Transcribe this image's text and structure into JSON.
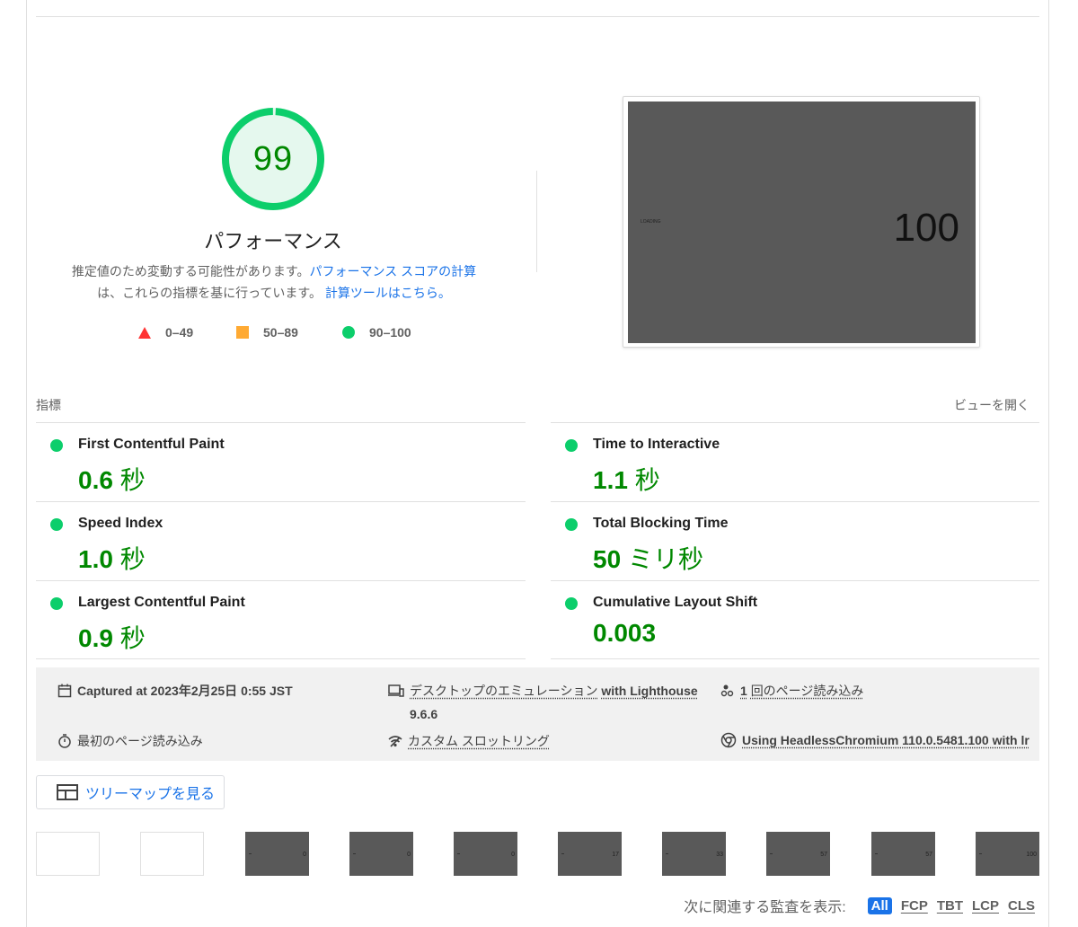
{
  "score": {
    "value": "99",
    "fraction": 0.99,
    "title": "パフォーマンス",
    "description_prefix": "推定値のため変動する可能性があります。",
    "description_link": "パフォーマンス スコアの計算",
    "description_middle": "は、これらの指標を基に行っています。",
    "calculator_link": "計算ツールはこちら。",
    "colors": {
      "pass": "#0cce6b",
      "average": "#ffaa33",
      "fail": "#ff3333",
      "pass_text": "#008800"
    }
  },
  "legend": [
    {
      "shape": "triangle",
      "label": "0–49"
    },
    {
      "shape": "square",
      "label": "50–89"
    },
    {
      "shape": "circle",
      "label": "90–100"
    }
  ],
  "final_screenshot": {
    "loading_text": "LOADING",
    "number": "100"
  },
  "metrics": {
    "heading": "指標",
    "toggle_label": "ビューを開く",
    "items": [
      {
        "title": "First Contentful Paint",
        "value": "0.6",
        "unit": "秒"
      },
      {
        "title": "Time to Interactive",
        "value": "1.1",
        "unit": "秒"
      },
      {
        "title": "Speed Index",
        "value": "1.0",
        "unit": "秒"
      },
      {
        "title": "Total Blocking Time",
        "value": "50",
        "unit": "ミリ秒"
      },
      {
        "title": "Largest Contentful Paint",
        "value": "0.9",
        "unit": "秒"
      },
      {
        "title": "Cumulative Layout Shift",
        "value": "0.003",
        "unit": ""
      }
    ]
  },
  "runtime": {
    "captured": "Captured at 2023年2月25日 0:55 JST",
    "emulation_link": "デスクトップのエミュレーション",
    "emulation_suffix": "with Lighthouse",
    "emulation_version": "9.6.6",
    "page_loads_count": "1",
    "page_loads_text": "回のページ読み込み",
    "first_load": "最初のページ読み込み",
    "throttling": "カスタム スロットリング",
    "browser": "Using HeadlessChromium 110.0.5481.100 with lr"
  },
  "treemap": {
    "label": "ツリーマップを見る",
    "icon": "treemap-icon"
  },
  "filmstrip": [
    "",
    "",
    "0",
    "0",
    "0",
    "17",
    "33",
    "57",
    "57",
    "100"
  ],
  "filter": {
    "label": "次に関連する監査を表示:",
    "chips": [
      "All",
      "FCP",
      "TBT",
      "LCP",
      "CLS"
    ],
    "active": "All"
  }
}
